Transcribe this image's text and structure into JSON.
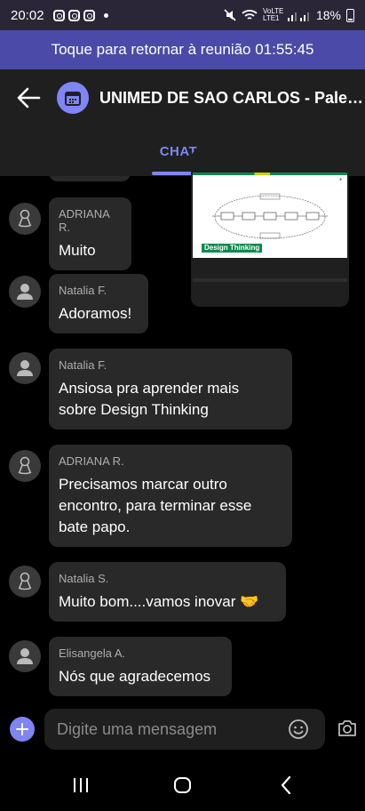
{
  "status_bar": {
    "time": "20:02",
    "network": "VoLTE LTE1",
    "battery": "18%"
  },
  "banner": {
    "text": "Toque para retornar à reunião 01:55:45"
  },
  "header": {
    "title": "UNIMED DE SAO CARLOS - Palestra...",
    "tab": "CHAT"
  },
  "share_preview": {
    "slide_label": "Design Thinking"
  },
  "messages": [
    {
      "name": "ADRIANA R.",
      "lines": [
        "Muito"
      ],
      "avatar": "ribbon-icon"
    },
    {
      "name": "Natalia F.",
      "lines": [
        "Adoramos!"
      ],
      "avatar": "person-icon"
    },
    {
      "name": "Natalia F.",
      "lines": [
        "Ansiosa pra aprender mais",
        "sobre Design Thinking"
      ],
      "avatar": "person-icon"
    },
    {
      "name": "ADRIANA R.",
      "lines": [
        "Precisamos marcar outro",
        "encontro, para terminar esse",
        "bate papo."
      ],
      "avatar": "ribbon-icon"
    },
    {
      "name": "Natalia S.",
      "lines": [
        "Muito bom....vamos inovar 🤝"
      ],
      "avatar": "ribbon-icon"
    },
    {
      "name": "Elisangela A.",
      "lines": [
        "Nós que agradecemos"
      ],
      "avatar": "person-icon"
    }
  ],
  "composer": {
    "placeholder": "Digite uma mensagem"
  },
  "colors": {
    "accent": "#7f85f5",
    "banner": "#4b4aa8",
    "bubble": "#292929"
  }
}
